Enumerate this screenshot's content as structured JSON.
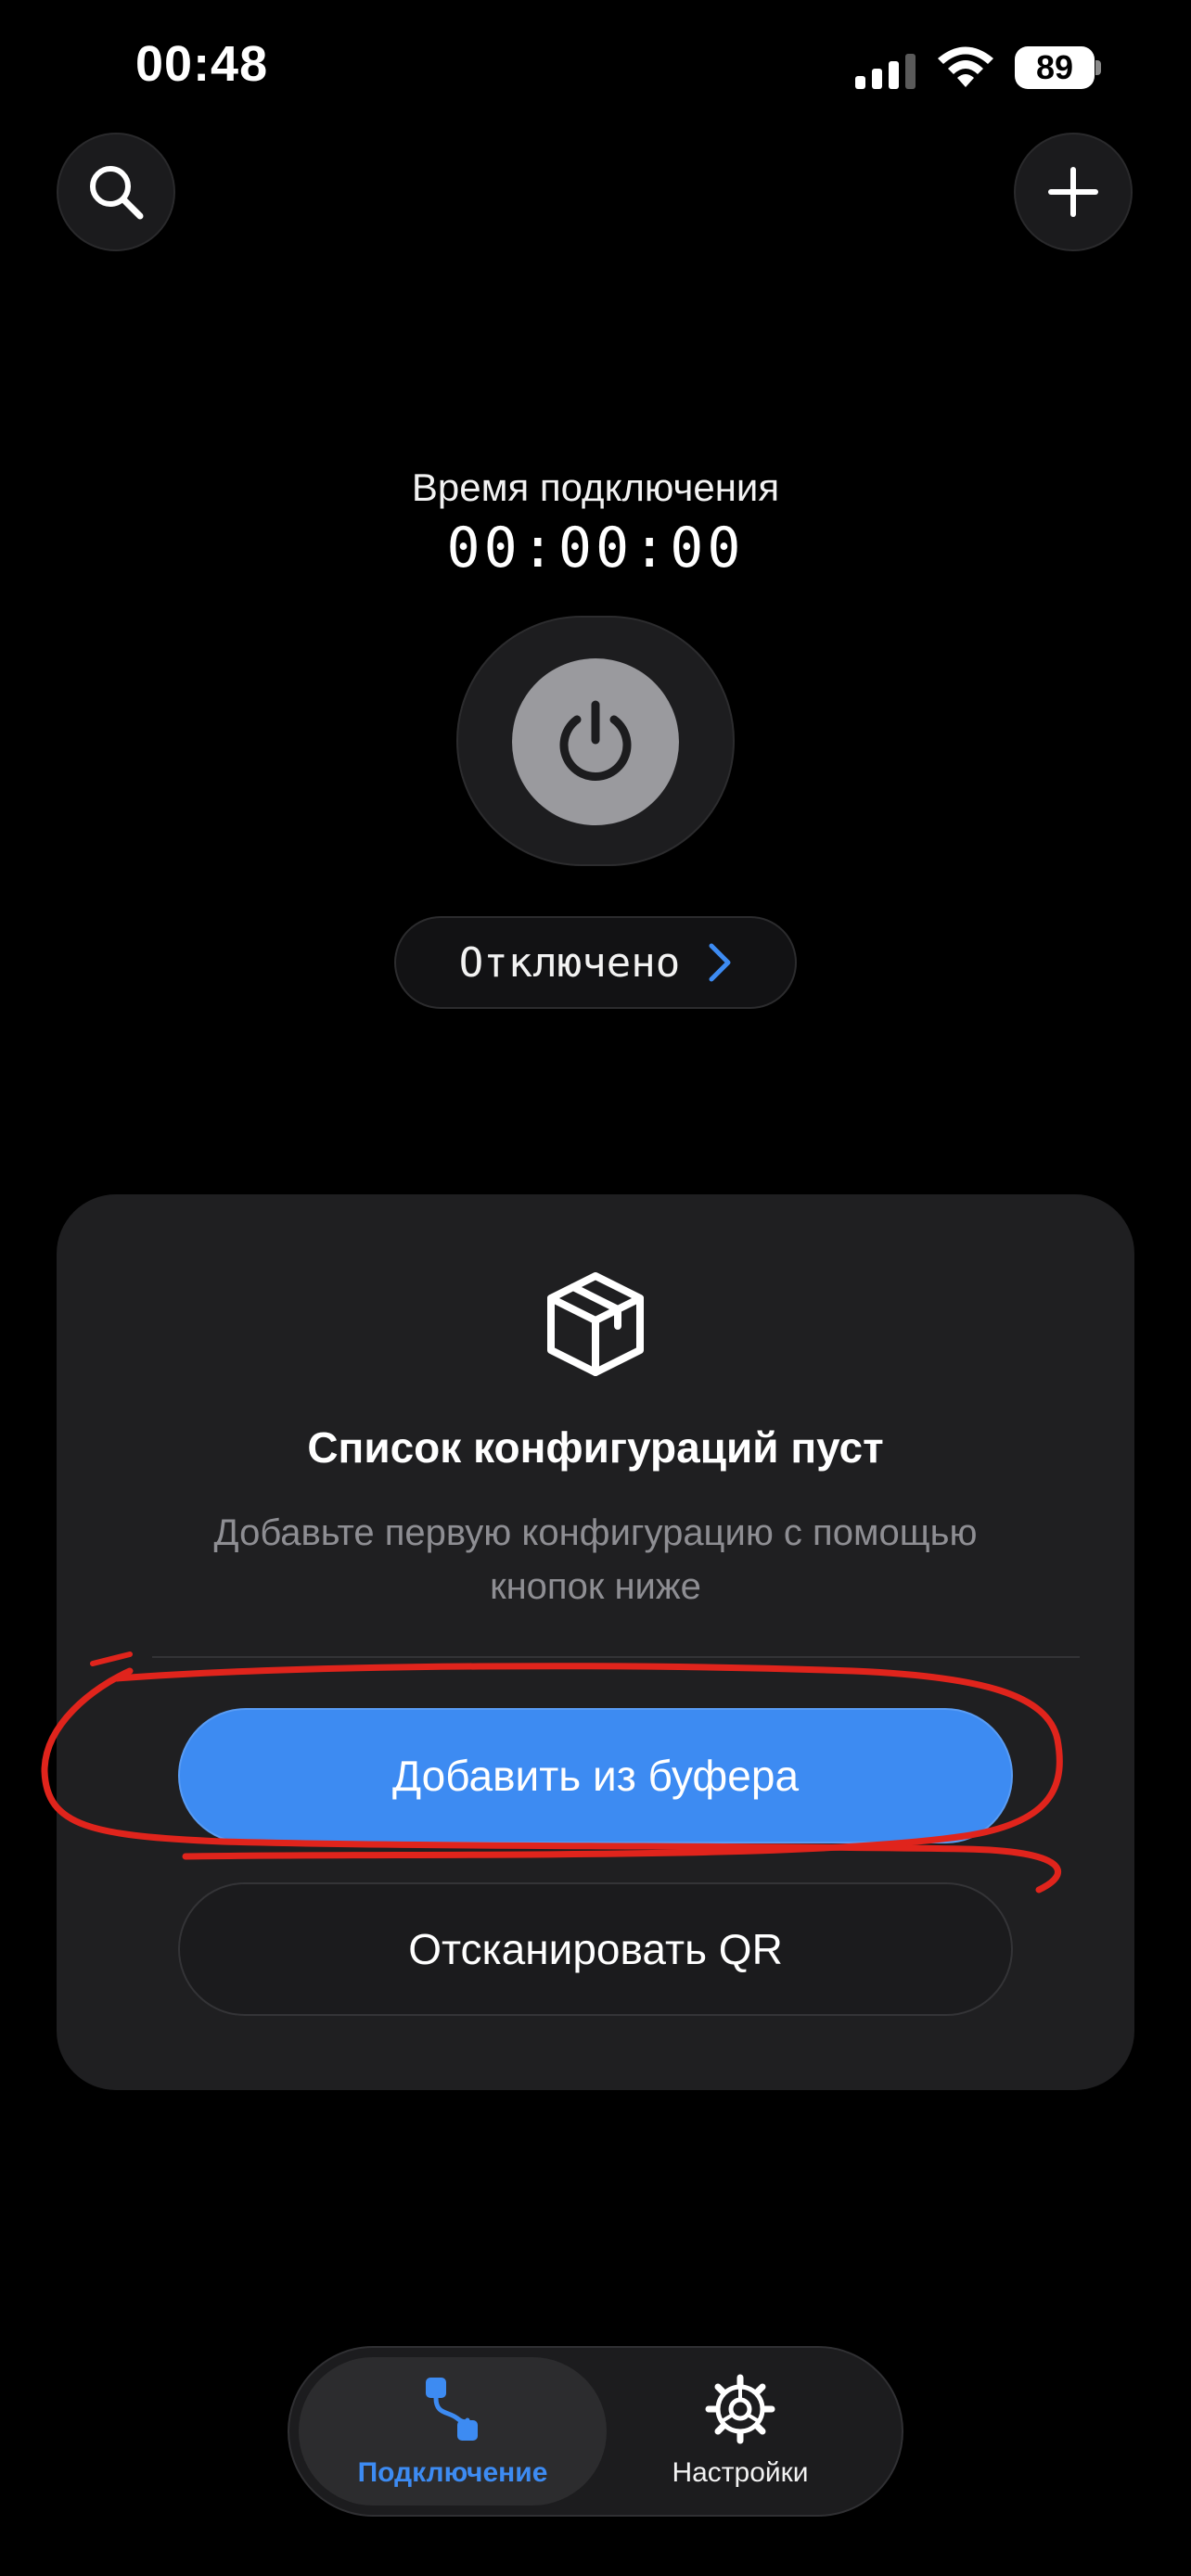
{
  "status_bar": {
    "time": "00:48",
    "battery": "89"
  },
  "top_bar": {
    "search_icon": "search-icon",
    "add_icon": "plus-icon"
  },
  "connection": {
    "time_label": "Время подключения",
    "time_value": "00:00:00",
    "status": "Отключено"
  },
  "empty_state": {
    "icon": "box-icon",
    "title": "Список конфигураций пуст",
    "subtitle_line1": "Добавьте первую конфигурацию с помощью",
    "subtitle_line2": "кнопок ниже",
    "primary_button": "Добавить из буфера",
    "secondary_button": "Отсканировать QR"
  },
  "tabs": [
    {
      "label": "Подключение",
      "icon": "connection-route-icon",
      "active": true
    },
    {
      "label": "Настройки",
      "icon": "gear-icon",
      "active": false
    }
  ],
  "colors": {
    "accent": "#3d8bf2",
    "annotation": "#e0241c",
    "card": "#1f1f21"
  }
}
